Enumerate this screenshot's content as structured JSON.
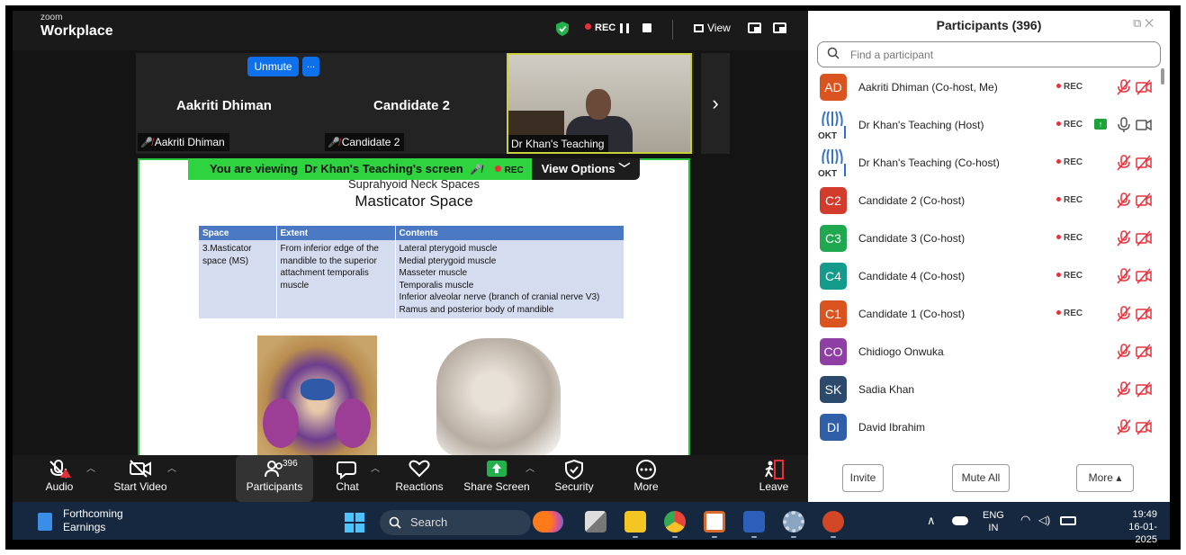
{
  "app": {
    "brand_small": "zoom",
    "brand": "Workplace",
    "rec_label": "REC",
    "view_label": "View"
  },
  "strip": {
    "unmute_label": "Unmute",
    "more_label": "...",
    "tiles": [
      {
        "big_name": "Aakriti Dhiman",
        "tag": "Aakriti Dhiman"
      },
      {
        "big_name": "Candidate 2",
        "tag": "Candidate 2"
      },
      {
        "tag": "Dr Khan's Teaching"
      }
    ]
  },
  "share": {
    "viewing_prefix": "You are viewing",
    "viewing_name": "Dr Khan's Teaching's screen",
    "rec": "REC",
    "view_options": "View Options"
  },
  "slide": {
    "title1": "Suprahyoid Neck Spaces",
    "title2": "Masticator  Space",
    "headers": [
      "Space",
      "Extent",
      "Contents"
    ],
    "space": "3.Masticator space (MS)",
    "extent": "From inferior edge of the mandible to the superior attachment temporalis muscle",
    "contents": [
      "Lateral pterygoid muscle",
      "Medial pterygoid muscle",
      "Masseter muscle",
      "Temporalis muscle",
      "Inferior alveolar nerve (branch of cranial nerve V3)",
      "Ramus and posterior body of mandible"
    ]
  },
  "toolbar": {
    "audio": "Audio",
    "start_video": "Start Video",
    "participants": "Participants",
    "participants_count": "396",
    "chat": "Chat",
    "reactions": "Reactions",
    "share_screen": "Share Screen",
    "security": "Security",
    "more": "More",
    "leave": "Leave"
  },
  "panel": {
    "title": "Participants (396)",
    "search_placeholder": "Find a participant",
    "rec": "REC",
    "participants": [
      {
        "initials": "AD",
        "color": "#d9541e",
        "name": "Aakriti Dhiman (Co-host, Me)"
      },
      {
        "initials": "OKT",
        "color": "#ffffff",
        "name": "Dr Khan's Teaching (Host)"
      },
      {
        "initials": "OKT",
        "color": "#ffffff",
        "name": "Dr Khan's Teaching (Co-host)"
      },
      {
        "initials": "C2",
        "color": "#d33b2c",
        "name": "Candidate 2 (Co-host)"
      },
      {
        "initials": "C3",
        "color": "#1fa84f",
        "name": "Candidate 3 (Co-host)"
      },
      {
        "initials": "C4",
        "color": "#159b8c",
        "name": "Candidate 4 (Co-host)"
      },
      {
        "initials": "C1",
        "color": "#d9541e",
        "name": "Candidate 1 (Co-host)"
      },
      {
        "initials": "CO",
        "color": "#8e3fa3",
        "name": "Chidiogo Onwuka"
      },
      {
        "initials": "SK",
        "color": "#2c4a6b",
        "name": "Sadia Khan"
      },
      {
        "initials": "DI",
        "color": "#2f5fa7",
        "name": "David Ibrahim"
      }
    ],
    "invite": "Invite",
    "mute_all": "Mute All",
    "more": "More"
  },
  "taskbar": {
    "widget_line1": "Forthcoming",
    "widget_line2": "Earnings",
    "search": "Search",
    "lang1": "ENG",
    "lang2": "IN",
    "time": "19:49",
    "date": "16-01-2025"
  },
  "colors": {
    "zoom_blue": "#0e71eb",
    "share_green": "#2fd23f",
    "rec_red": "#e8303a",
    "taskbar": "#16283f"
  }
}
